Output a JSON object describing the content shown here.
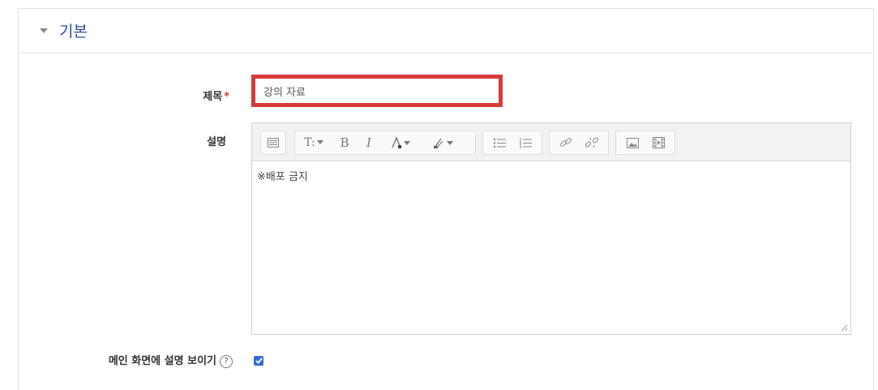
{
  "section": {
    "title": "기본"
  },
  "form": {
    "title_label": "제목",
    "required_mark": "*",
    "title_value": "강의 자료",
    "description_label": "설명",
    "description_text": "※배포 금지",
    "show_on_main_label": "메인 화면에 설명 보이기",
    "help_glyph": "?",
    "show_on_main_checked": true
  },
  "toolbar": {
    "buttons": [
      "toggle-toolbar-icon",
      "paragraph-styles-icon",
      "bold-icon",
      "italic-icon",
      "font-color-icon",
      "background-color-icon",
      "unordered-list-icon",
      "ordered-list-icon",
      "link-icon",
      "unlink-icon",
      "image-icon",
      "media-icon"
    ],
    "bold_glyph": "B",
    "italic_glyph": "I",
    "styles_glyph": "T:"
  },
  "colors": {
    "section_title": "#2f4ea1",
    "highlight_border": "#d63b3b",
    "checkbox": "#2f6fd6",
    "required": "#d43f3a"
  }
}
